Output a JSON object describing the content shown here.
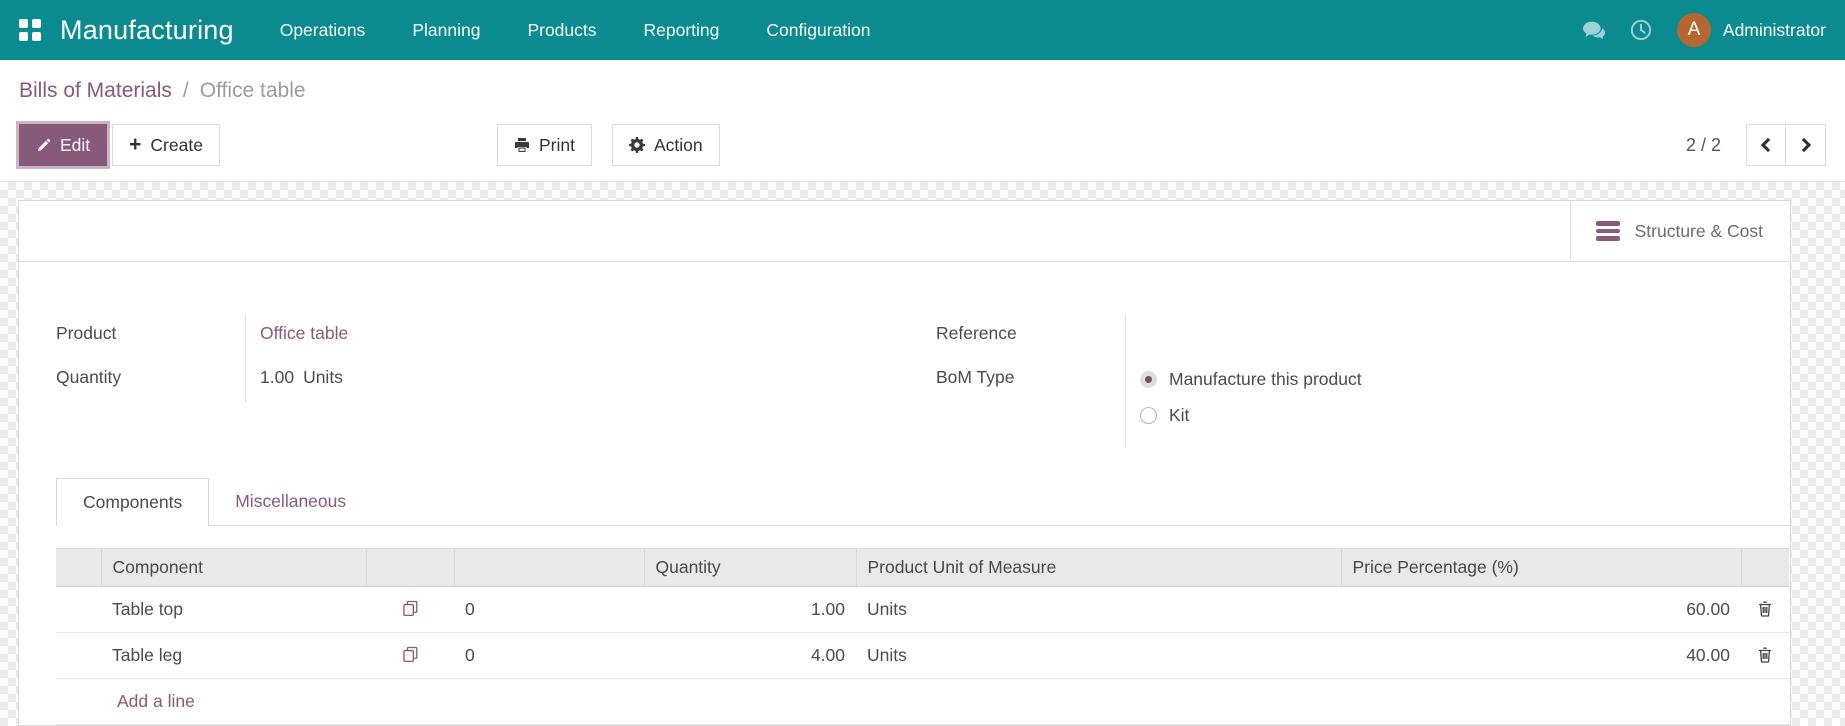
{
  "navbar": {
    "app_name": "Manufacturing",
    "menus": [
      "Operations",
      "Planning",
      "Products",
      "Reporting",
      "Configuration"
    ],
    "user": {
      "initial": "A",
      "name": "Administrator"
    },
    "icons": [
      "apps-grid-icon",
      "chat-bubbles-icon",
      "clock-icon"
    ]
  },
  "breadcrumb": {
    "parent": "Bills of Materials",
    "separator": "/",
    "current": "Office table"
  },
  "control_panel": {
    "edit_label": "Edit",
    "create_label": "Create",
    "print_label": "Print",
    "action_label": "Action",
    "pager": {
      "value": "2 / 2"
    },
    "icons": [
      "pencil-icon",
      "plus-icon",
      "printer-icon",
      "gear-icon",
      "chevron-left-icon",
      "chevron-right-icon"
    ]
  },
  "sheet": {
    "smart_button": {
      "label": "Structure & Cost",
      "icon": "bars-icon"
    },
    "fields": {
      "product": {
        "label": "Product",
        "value": "Office table"
      },
      "quantity": {
        "label": "Quantity",
        "value": "1.00",
        "uom": "Units"
      },
      "reference": {
        "label": "Reference",
        "value": ""
      },
      "bom_type": {
        "label": "BoM Type",
        "options": [
          {
            "label": "Manufacture this product",
            "selected": true
          },
          {
            "label": "Kit",
            "selected": false
          }
        ]
      }
    },
    "tabs": [
      {
        "label": "Components",
        "active": true
      },
      {
        "label": "Miscellaneous",
        "active": false
      }
    ],
    "components_table": {
      "headers": [
        "",
        "Component",
        "",
        "",
        "Quantity",
        "Product Unit of Measure",
        "Price Percentage (%)",
        ""
      ],
      "rows": [
        {
          "component": "Table top",
          "copies": "0",
          "quantity": "1.00",
          "uom": "Units",
          "price_pct": "60.00"
        },
        {
          "component": "Table leg",
          "copies": "0",
          "quantity": "4.00",
          "uom": "Units",
          "price_pct": "40.00"
        }
      ],
      "add_line_label": "Add a line",
      "row_icons": [
        "copy-icon",
        "trash-icon"
      ]
    }
  },
  "colors": {
    "navbar_bg": "#0b8b8f",
    "brand_purple": "#875A7B",
    "avatar_bg": "#b4672e",
    "breadcrumb_current": "#9c9c9c",
    "table_header_bg": "#e9e9e9",
    "checker_light": "#ffffff",
    "checker_dark": "#ebebeb"
  }
}
